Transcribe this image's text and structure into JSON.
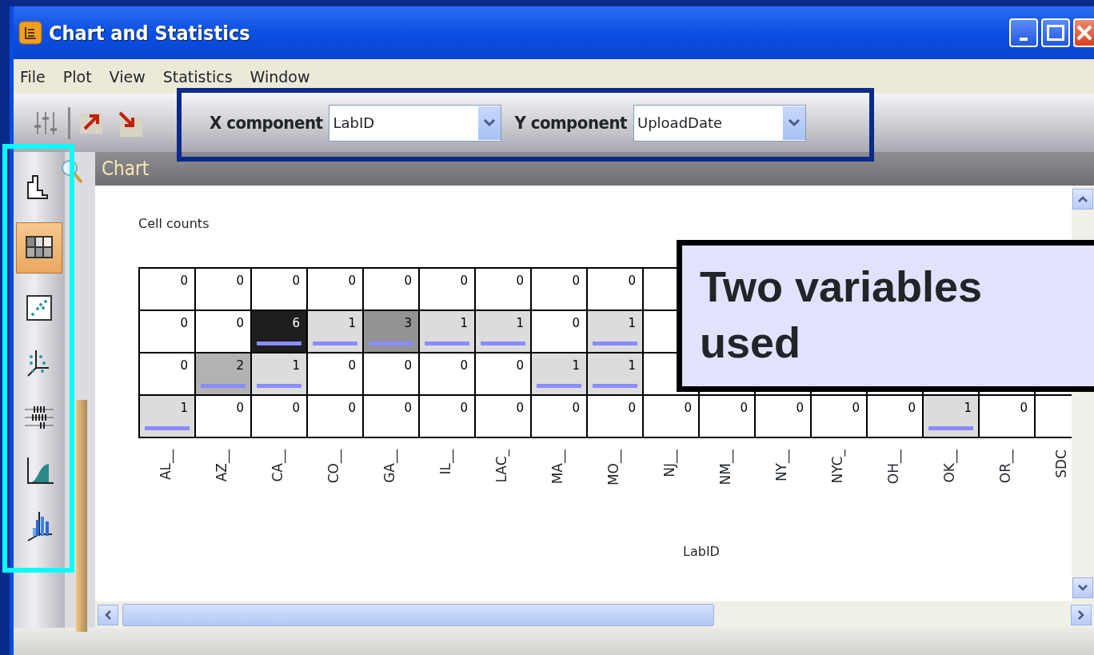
{
  "window": {
    "title": "Chart and Statistics"
  },
  "menu": [
    "File",
    "Plot",
    "View",
    "Statistics",
    "Window"
  ],
  "toolbar": {
    "x_component": {
      "label": "X component",
      "value": "LabID"
    },
    "y_component": {
      "label": "Y component",
      "value": "UploadDate"
    }
  },
  "plot_types": [
    {
      "kind": "histogram",
      "selected": false
    },
    {
      "kind": "heatmap",
      "selected": true
    },
    {
      "kind": "scatter",
      "selected": false
    },
    {
      "kind": "scatter3d",
      "selected": false
    },
    {
      "kind": "strip",
      "selected": false
    },
    {
      "kind": "cdf",
      "selected": false
    },
    {
      "kind": "bar3d",
      "selected": false
    }
  ],
  "chart": {
    "title": "Chart",
    "subtitle": "Cell counts",
    "xlabel": "LabID",
    "rows": [
      {
        "cells": [
          "0",
          "0",
          "0",
          "0",
          "0",
          "0",
          "0",
          "0",
          "0",
          null,
          null,
          null,
          null,
          null,
          null,
          null,
          null
        ]
      },
      {
        "cells": [
          "0",
          "0",
          "6",
          "1",
          "3",
          "1",
          "1",
          "0",
          "1",
          null,
          null,
          null,
          null,
          null,
          null,
          null,
          null
        ]
      },
      {
        "cells": [
          "0",
          "2",
          "1",
          "0",
          "0",
          "0",
          "0",
          "1",
          "1",
          null,
          null,
          null,
          null,
          null,
          null,
          null,
          null
        ]
      },
      {
        "cells": [
          "1",
          "0",
          "0",
          "0",
          "0",
          "0",
          "0",
          "0",
          "0",
          "0",
          "0",
          "0",
          "0",
          "0",
          "1",
          "0",
          null
        ]
      }
    ],
    "x_categories": [
      "AL__",
      "AZ__",
      "CA__",
      "CO__",
      "GA__",
      "IL__",
      "LAC_",
      "MA__",
      "MO__",
      "NJ__",
      "NM__",
      "NY__",
      "NYC_",
      "OH__",
      "OK__",
      "OR__",
      "SDC"
    ]
  },
  "callout": {
    "text": "Two variables used"
  }
}
